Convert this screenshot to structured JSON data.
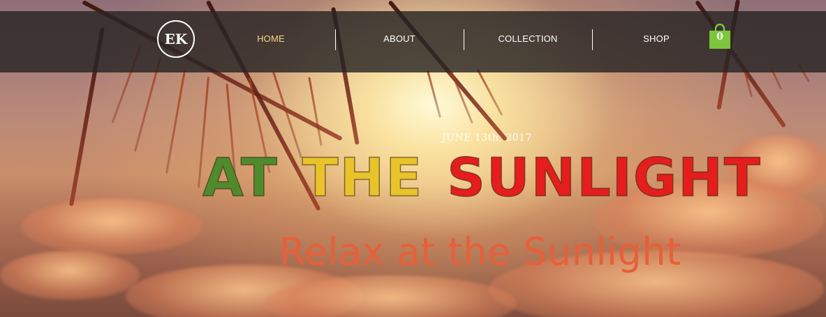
{
  "logo": {
    "text": "EK"
  },
  "nav": {
    "items": [
      {
        "label": "HOME",
        "active": true
      },
      {
        "label": "ABOUT",
        "active": false
      },
      {
        "label": "COLLECTION",
        "active": false
      },
      {
        "label": "SHOP",
        "active": false
      }
    ]
  },
  "cart": {
    "count": "0",
    "icon": "shopping-bag-icon",
    "color": "#7cc63d"
  },
  "hero": {
    "date": "JUNE 13th, 2017",
    "title_words": [
      "AT",
      "THE",
      "SUNLIGHT"
    ],
    "title_colors": [
      "#4f8a2c",
      "#e8c42a",
      "#e51d1d"
    ],
    "subtitle": "Relax at the Sunlight",
    "subtitle_color": "#e6603a"
  },
  "colors": {
    "navbar_bg": "#282424",
    "nav_active": "#f5d88a"
  }
}
